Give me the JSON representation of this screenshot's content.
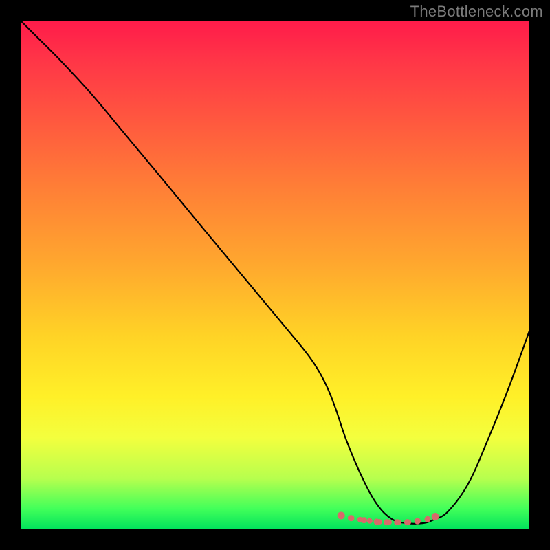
{
  "watermark": "TheBottleneck.com",
  "chart_data": {
    "type": "line",
    "title": "",
    "xlabel": "",
    "ylabel": "",
    "ylim": [
      0,
      100
    ],
    "series": [
      {
        "name": "bottleneck-curve",
        "x": [
          0,
          3,
          8,
          14,
          20,
          28,
          36,
          44,
          52,
          57,
          60,
          62,
          64,
          67,
          70,
          73,
          76,
          79,
          81,
          84,
          88,
          92,
          96,
          100
        ],
        "values": [
          100,
          97,
          92,
          85.5,
          78.3,
          68.7,
          59,
          49.4,
          39.8,
          33.6,
          28.5,
          23.5,
          17.6,
          10.5,
          5,
          2,
          1.2,
          1.2,
          1.8,
          3.5,
          9,
          18,
          28,
          39
        ]
      }
    ],
    "highlight_points": {
      "name": "minimum-zone",
      "x": [
        63.0,
        65.0,
        67.5,
        70.0,
        72.0,
        74.0,
        76.0,
        78.0,
        80.0,
        81.5
      ],
      "values": [
        2.7,
        2.2,
        1.8,
        1.5,
        1.4,
        1.4,
        1.4,
        1.6,
        2.0,
        2.5
      ]
    },
    "gradient_stops": [
      {
        "pos": 0.0,
        "color": "#ff1b4a"
      },
      {
        "pos": 0.08,
        "color": "#ff3647"
      },
      {
        "pos": 0.18,
        "color": "#ff5340"
      },
      {
        "pos": 0.33,
        "color": "#ff7f36"
      },
      {
        "pos": 0.48,
        "color": "#ffa82e"
      },
      {
        "pos": 0.62,
        "color": "#ffd326"
      },
      {
        "pos": 0.74,
        "color": "#fff028"
      },
      {
        "pos": 0.82,
        "color": "#f3ff3e"
      },
      {
        "pos": 0.9,
        "color": "#b7ff4e"
      },
      {
        "pos": 0.96,
        "color": "#41ff5a"
      },
      {
        "pos": 1.0,
        "color": "#00e25c"
      }
    ]
  }
}
